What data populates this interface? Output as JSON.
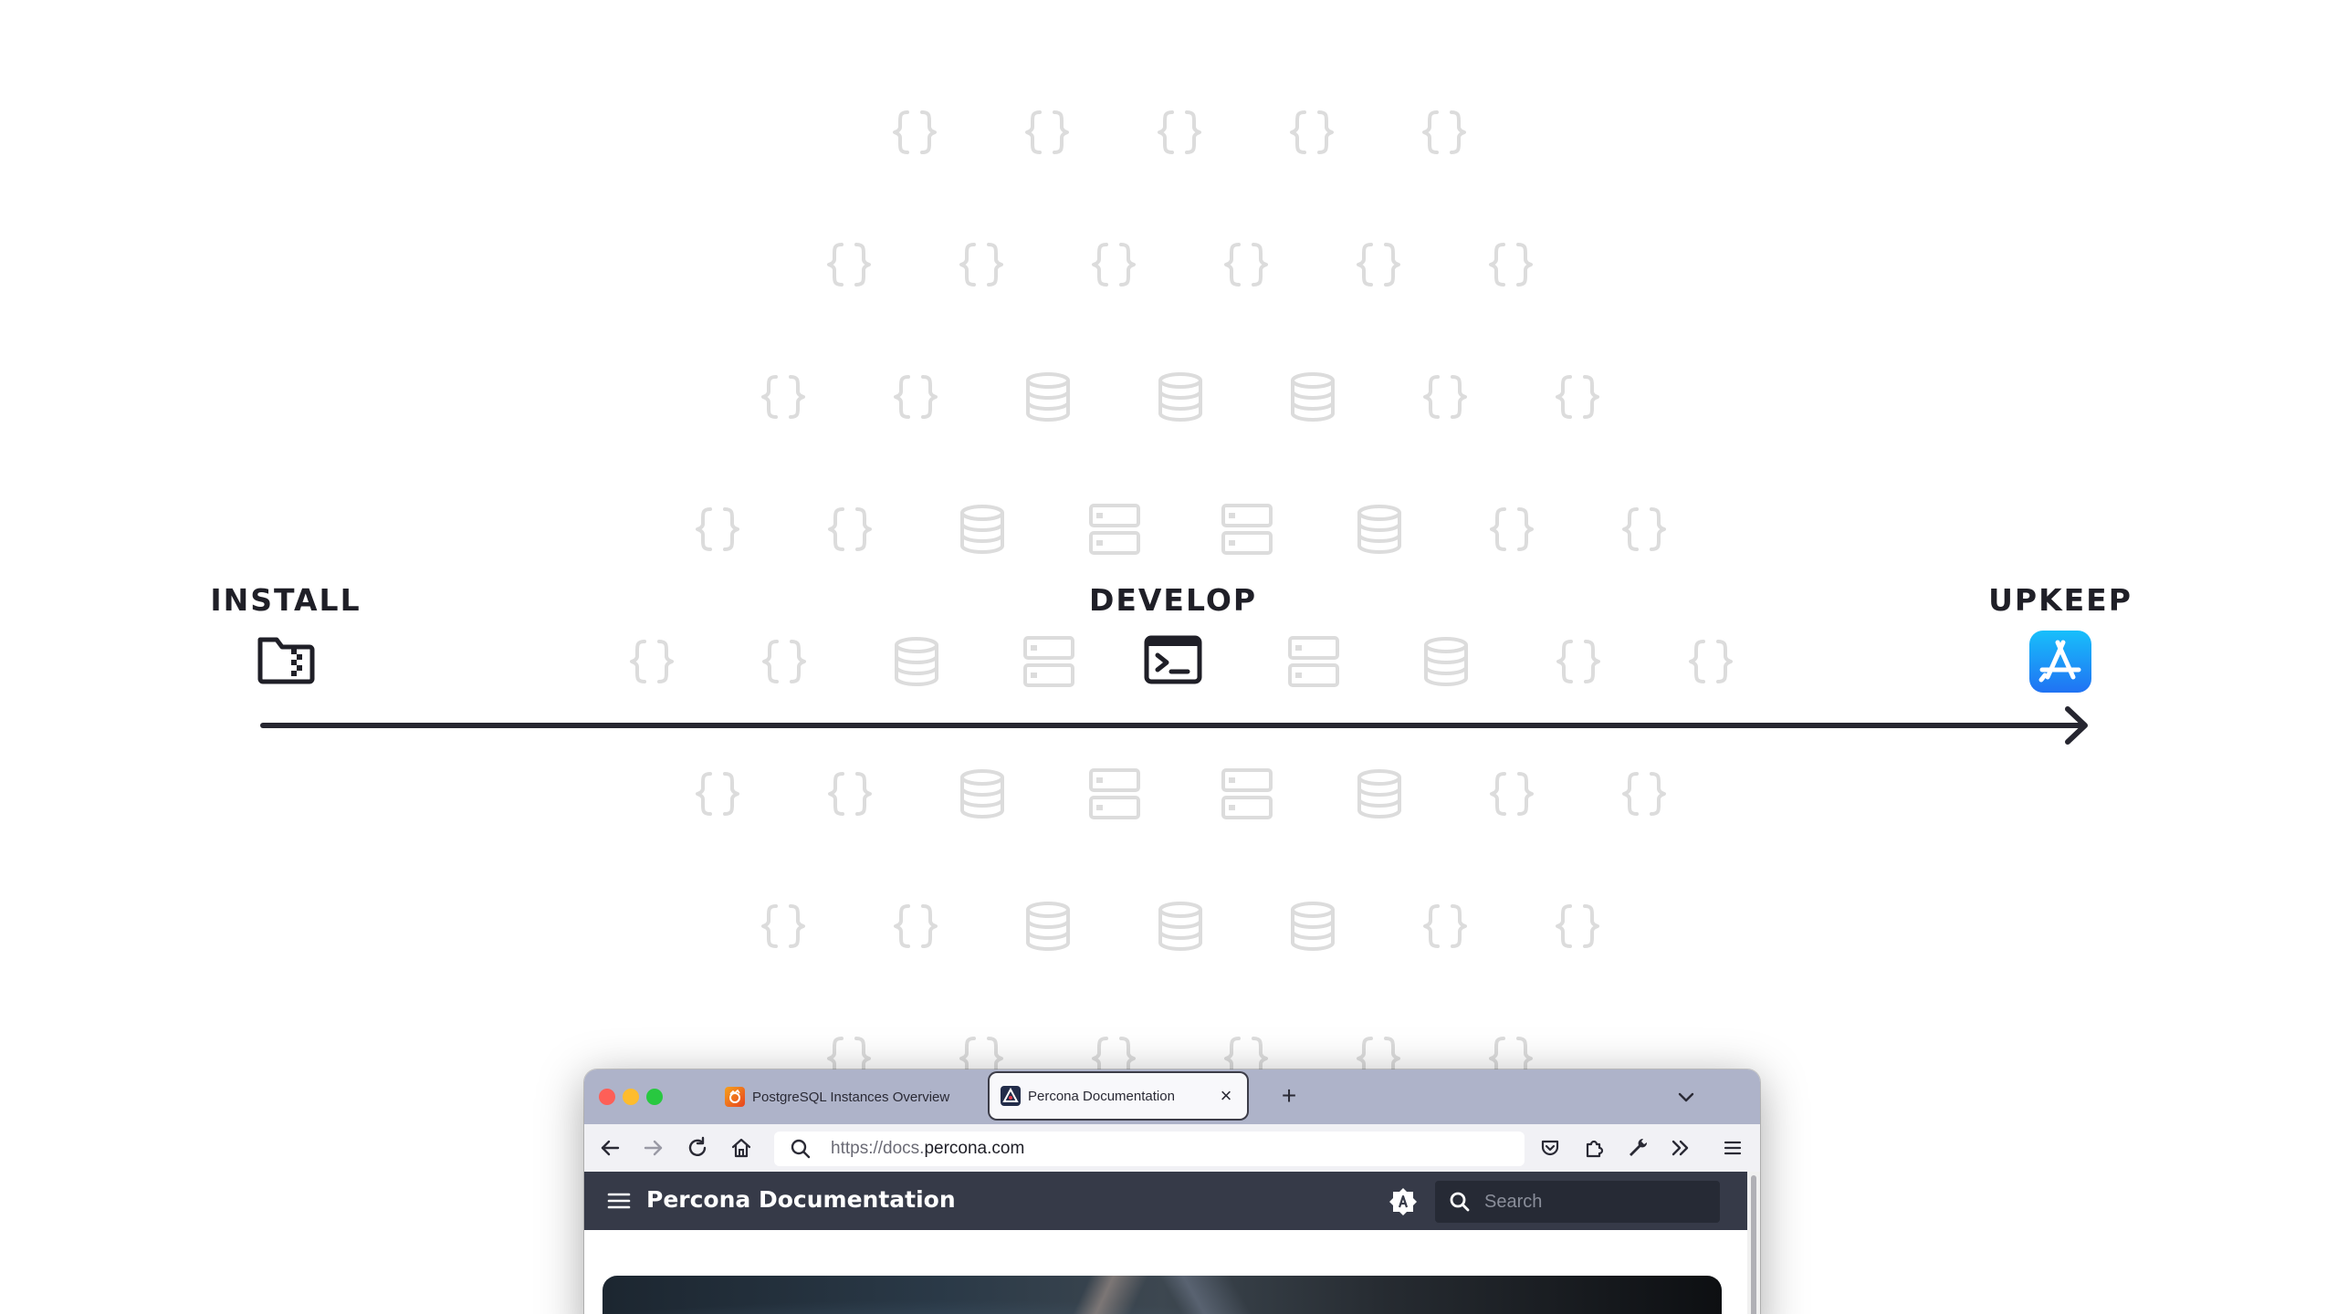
{
  "stages": {
    "install": {
      "label": "INSTALL",
      "icon": "folder-zip-icon"
    },
    "develop": {
      "label": "DEVELOP",
      "icon": "terminal-icon"
    },
    "upkeep": {
      "label": "UPKEEP",
      "icon": "app-store-icon"
    }
  },
  "timeline": {
    "icon": "arrow-right-icon"
  },
  "background": {
    "icons": [
      "curly-braces-icon",
      "database-icon",
      "server-icon"
    ]
  },
  "browser": {
    "tabs": [
      {
        "title": "PostgreSQL Instances Overview",
        "favicon": "grafana-icon",
        "active": false
      },
      {
        "title": "Percona Documentation",
        "favicon": "percona-icon",
        "active": true
      }
    ],
    "url": {
      "scheme": "https://docs.",
      "host": "percona.com"
    },
    "page": {
      "site_title": "Percona Documentation",
      "search_placeholder": "Search"
    }
  },
  "colors": {
    "text": "#1f1f27",
    "pattern": "#dcdcdc",
    "tabbar": "#aeb3c9",
    "header": "#363a48",
    "appstore_blue": "#1f8fff"
  }
}
